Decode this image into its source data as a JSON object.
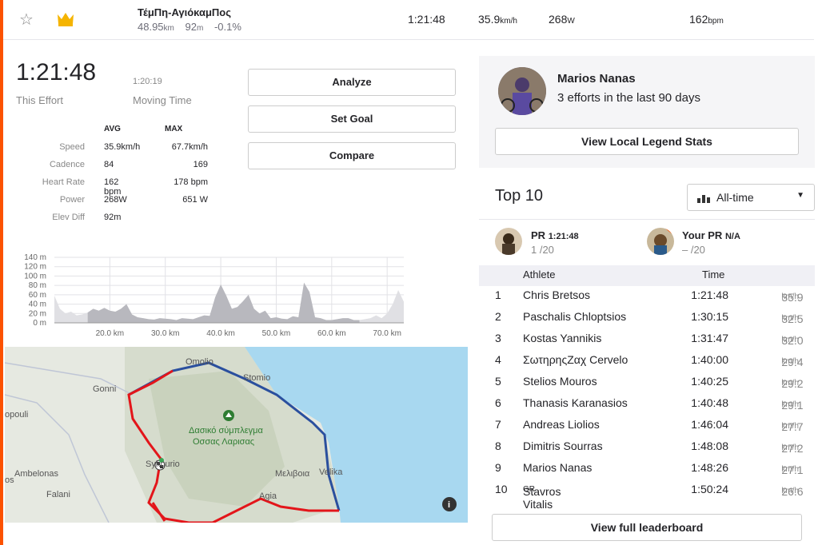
{
  "segment": {
    "name": "ΤέμΠη-ΑγιόκαμΠος",
    "distance": "48.95",
    "distance_unit": "km",
    "elev": "92",
    "elev_unit": "m",
    "grade": "-0.1%",
    "time": "1:21:48",
    "speed": "35.9",
    "speed_unit": "km/h",
    "power": "268",
    "power_unit": "W",
    "hr": "162",
    "hr_unit": "bpm"
  },
  "effort": {
    "time": "1:21:48",
    "time_label": "This Effort",
    "moving_time": "1:20:19",
    "moving_label": "Moving Time"
  },
  "stats": {
    "avg_header": "AVG",
    "max_header": "MAX",
    "rows": [
      {
        "label": "Speed",
        "avg": "35.9km/h",
        "max": "67.7km/h"
      },
      {
        "label": "Cadence",
        "avg": "84",
        "max": "169"
      },
      {
        "label": "Heart Rate",
        "avg": "162 bpm",
        "max": "178 bpm"
      },
      {
        "label": "Power",
        "avg": "268W",
        "max": "651 W"
      },
      {
        "label": "Elev Diff",
        "avg": "92m",
        "max": ""
      }
    ]
  },
  "buttons": {
    "analyze": "Analyze",
    "set_goal": "Set Goal",
    "compare": "Compare"
  },
  "chart_data": {
    "type": "area",
    "y_ticks": [
      "140 m",
      "120 m",
      "100 m",
      "80 m",
      "60 m",
      "40 m",
      "20 m",
      "0 m"
    ],
    "x_ticks": [
      "20.0 km",
      "30.0 km",
      "40.0 km",
      "50.0 km",
      "60.0 km",
      "70.0 km"
    ],
    "ylim": [
      0,
      140
    ],
    "xlim": [
      10,
      73
    ],
    "highlight_range": [
      16,
      65
    ],
    "x": [
      10,
      11,
      12,
      13,
      14,
      15,
      16,
      17,
      18,
      19,
      20,
      21,
      22,
      23,
      24,
      25,
      26,
      27,
      28,
      29,
      30,
      31,
      32,
      33,
      34,
      35,
      36,
      37,
      38,
      39,
      40,
      41,
      42,
      43,
      44,
      45,
      46,
      47,
      48,
      49,
      50,
      51,
      52,
      53,
      54,
      55,
      56,
      57,
      58,
      59,
      60,
      61,
      62,
      63,
      64,
      65,
      66,
      67,
      68,
      69,
      70,
      71,
      72,
      73
    ],
    "y": [
      58,
      30,
      20,
      24,
      16,
      18,
      22,
      30,
      26,
      32,
      26,
      24,
      30,
      40,
      18,
      12,
      10,
      8,
      7,
      10,
      9,
      8,
      6,
      10,
      9,
      8,
      12,
      16,
      15,
      55,
      82,
      58,
      30,
      34,
      46,
      60,
      30,
      20,
      26,
      10,
      12,
      9,
      8,
      14,
      12,
      86,
      66,
      12,
      10,
      6,
      6,
      8,
      10,
      10,
      6,
      6,
      8,
      10,
      16,
      10,
      20,
      40,
      70,
      45
    ],
    "grid": true
  },
  "map": {
    "labels": [
      "Omolio",
      "Stomio",
      "Gonni",
      "opouli",
      "Δασικό σύμπλεγμα",
      "Οσσας Λαρισας",
      "Sykourio",
      "Μελιβοια",
      "Velika",
      "Ambelonas",
      "Falani",
      "Agia",
      "os"
    ]
  },
  "legend": {
    "name": "Marios Nanas",
    "subtitle": "3 efforts in the last 90 days",
    "button": "View Local Legend Stats"
  },
  "leaderboard": {
    "title": "Top 10",
    "filter": "All-time",
    "pr_label": "PR",
    "pr_time": "1:21:48",
    "pr_rank": "1 /20",
    "your_pr_label": "Your PR",
    "your_pr_value": "N/A",
    "your_pr_rank": "– /20",
    "col_athlete": "Athlete",
    "col_time": "Time",
    "rows": [
      {
        "rank": "1",
        "name": "Chris Bretsos",
        "time": "1:21:48",
        "speed": "35.9"
      },
      {
        "rank": "2",
        "name": "Paschalis Chloptsios",
        "time": "1:30:15",
        "speed": "32.5"
      },
      {
        "rank": "3",
        "name": "Kostas Yannikis",
        "time": "1:31:47",
        "speed": "32.0"
      },
      {
        "rank": "4",
        "name": "ΣωτηρηςΖαχ Cervelo",
        "time": "1:40:00",
        "speed": "29.4"
      },
      {
        "rank": "5",
        "name": "Stelios Mouros",
        "time": "1:40:25",
        "speed": "29.2"
      },
      {
        "rank": "6",
        "name": "Thanasis Karanasios",
        "time": "1:40:48",
        "speed": "29.1"
      },
      {
        "rank": "7",
        "name": "Andreas Liolios",
        "time": "1:46:04",
        "speed": "27.7"
      },
      {
        "rank": "8",
        "name": "Dimitris Sourras",
        "time": "1:48:08",
        "speed": "27.2"
      },
      {
        "rank": "9",
        "name": "Marios Nanas",
        "time": "1:48:26",
        "speed": "27.1"
      },
      {
        "rank": "10",
        "name": "Stavros Vitalis",
        "time": "1:50:24",
        "speed": "26.6"
      }
    ],
    "speed_unit": "km/h",
    "gr_badge": "GR",
    "button": "View full leaderboard"
  },
  "colors": {
    "accent": "#fc5200",
    "route_red": "#e3151a",
    "route_blue": "#2a4f9e",
    "water": "#a8d8f0",
    "land": "#e8ebe4"
  }
}
